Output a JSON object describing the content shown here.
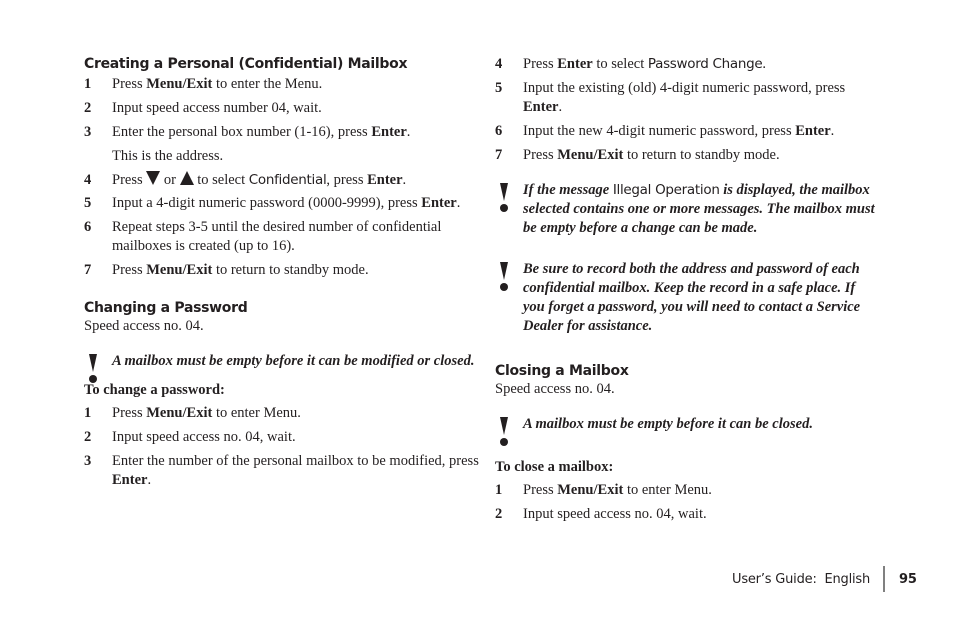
{
  "left": {
    "section1": {
      "title": "Creating a Personal (Confidential) Mailbox",
      "steps": [
        {
          "num": "1",
          "pre": "Press ",
          "bold": "Menu/Exit",
          "post": " to enter the Menu."
        },
        {
          "num": "2",
          "text": "Input speed access number 04, wait."
        },
        {
          "num": "3",
          "pre": "Enter the personal box number (1-16), press ",
          "bold": "Enter",
          "post": ".",
          "extra": "This is the address."
        },
        {
          "num": "4",
          "pre": "Press ",
          "mid1": " or ",
          "mid2": " to select ",
          "ui": "Confidential",
          "post1": ", press ",
          "bold": "Enter",
          "post": "."
        },
        {
          "num": "5",
          "pre": "Input a 4-digit numeric password (0000-9999), press ",
          "bold": "Enter",
          "post": "."
        },
        {
          "num": "6",
          "text": "Repeat steps 3-5 until the desired number of confidential mailboxes is created (up to 16)."
        },
        {
          "num": "7",
          "pre": "Press ",
          "bold": "Menu/Exit",
          "post": " to return to standby mode."
        }
      ]
    },
    "section2": {
      "title": "Changing a Password",
      "speed": "Speed access no. 04.",
      "note": " A mailbox must be empty before it can be modified or closed.",
      "subtitle": "To change a password:",
      "steps": [
        {
          "num": "1",
          "pre": "Press ",
          "bold": "Menu/Exit",
          "post": " to enter Menu."
        },
        {
          "num": "2",
          "text": "Input speed access no. 04, wait."
        },
        {
          "num": "3",
          "pre": "Enter the number of the personal mailbox to be modified, press ",
          "bold": "Enter",
          "post": "."
        }
      ]
    }
  },
  "right": {
    "steps": [
      {
        "num": "4",
        "pre": "Press ",
        "bold": "Enter",
        "mid": " to select ",
        "ui": "Password Change",
        "post": "."
      },
      {
        "num": "5",
        "pre": "Input the existing (old) 4-digit numeric password, press ",
        "bold": "Enter",
        "post": "."
      },
      {
        "num": "6",
        "pre": "Input the new 4-digit numeric password, press ",
        "bold": "Enter",
        "post": "."
      },
      {
        "num": "7",
        "pre": "Press ",
        "bold": "Menu/Exit",
        "post": " to return to standby mode."
      }
    ],
    "note1": {
      "pre": " If the message ",
      "ui": "Illegal Operation",
      "post": "  is displayed, the mailbox selected contains one or more messages.  The mailbox must be empty before a change can be made."
    },
    "note2": "Be sure to record both the address and password of each confidential mailbox.  Keep the record in a safe place.  If you forget a password, you will need to contact a Service Dealer for assistance.",
    "section3": {
      "title": "Closing a Mailbox",
      "speed": "Speed access no. 04.",
      "note": "A mailbox must be empty before it can be closed.",
      "subtitle": "To close a mailbox:",
      "steps": [
        {
          "num": "1",
          "pre": "Press ",
          "bold": "Menu/Exit",
          "post": " to enter Menu."
        },
        {
          "num": "2",
          "text": "Input speed access no. 04, wait."
        }
      ]
    }
  },
  "footer": {
    "guide": "User’s Guide:  English",
    "page": "95"
  }
}
